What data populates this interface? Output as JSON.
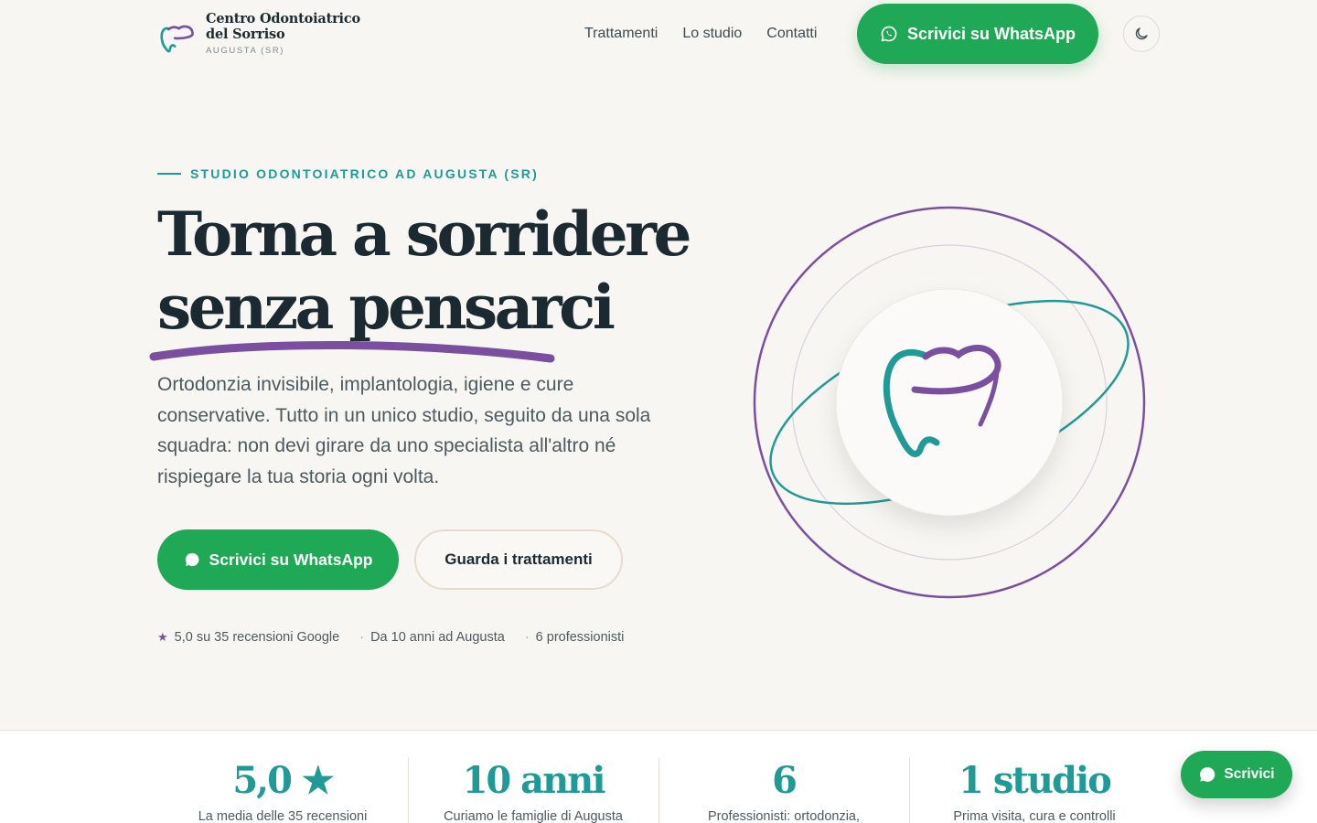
{
  "brand": {
    "line1": "Centro Odontoiatrico",
    "line2": "del Sorriso",
    "location": "AUGUSTA (SR)",
    "logo_icon": "tooth-logo-icon"
  },
  "nav": {
    "items": [
      {
        "label": "Trattamenti"
      },
      {
        "label": "Lo studio"
      },
      {
        "label": "Contatti"
      }
    ],
    "whatsapp_label": "Scrivici su WhatsApp",
    "theme_toggle_icon": "moon-icon"
  },
  "hero": {
    "eyebrow": "STUDIO ODONTOIATRICO AD AUGUSTA (SR)",
    "headline_line1": "Torna a sorridere",
    "headline_line2": "senza pensarci",
    "lead": "Ortodonzia invisibile, implantologia, igiene e cure conservative. Tutto in un unico studio, seguito da una sola squadra: non devi girare da uno specialista all'altro né rispiegare la tua storia ogni volta.",
    "primary_cta": "Scrivici su WhatsApp",
    "secondary_cta": "Guarda i trattamenti",
    "trust": {
      "rating": "5,0 su 35 recensioni Google",
      "years": "Da 10 anni ad Augusta",
      "team": "6 professionisti"
    }
  },
  "stats": [
    {
      "value": "5,0 ★",
      "label": "La media delle 35 recensioni"
    },
    {
      "value": "10 anni",
      "label": "Curiamo le famiglie di Augusta"
    },
    {
      "value": "6",
      "label": "Professionisti: ortodonzia,"
    },
    {
      "value": "1 studio",
      "label": "Prima visita, cura e controlli"
    }
  ],
  "floating_chat": {
    "label": "Scrivici"
  },
  "colors": {
    "background": "#f8f6f2",
    "whatsapp_green": "#1fa855",
    "teal": "#1f9a96",
    "purple": "#7a4fa0",
    "ink": "#1a2a30"
  }
}
